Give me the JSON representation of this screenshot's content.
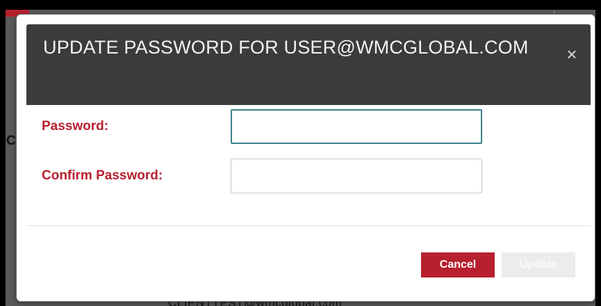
{
  "background": {
    "partial_letter": "C",
    "partial_email": "CLIENTTEST@wmcglobal.com"
  },
  "modal": {
    "title": "UPDATE PASSWORD FOR USER@WMCGLOBAL.COM",
    "close_glyph": "×",
    "close_icon": "close-icon"
  },
  "form": {
    "password_label": "Password:",
    "password_value": "",
    "confirm_label": "Confirm Password:",
    "confirm_value": ""
  },
  "footer": {
    "cancel_label": "Cancel",
    "update_label": "Update",
    "update_disabled": true
  },
  "colors": {
    "accent": "#b7202e",
    "header_bg": "#3b3b3b",
    "focus_border": "#3c7f8c"
  }
}
